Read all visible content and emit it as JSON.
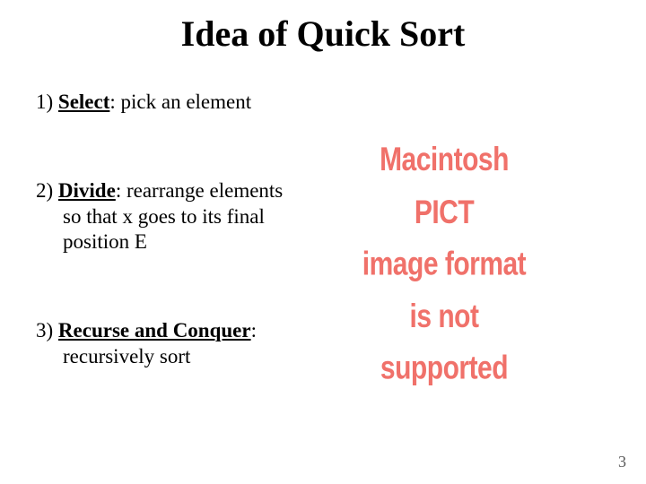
{
  "title": "Idea of Quick Sort",
  "items": {
    "select": {
      "num": "1) ",
      "label": "Select",
      "desc": ": pick an element"
    },
    "divide": {
      "num": "2) ",
      "label": "Divide",
      "desc": ": rearrange elements",
      "cont1": "so that x goes to its final",
      "cont2": "position E"
    },
    "recurse": {
      "num": "3) ",
      "label": "Recurse and Conquer",
      "desc": ":",
      "cont1": "recursively sort"
    }
  },
  "pict": {
    "l1": "Macintosh PICT",
    "l2": "image format",
    "l3": "is not supported"
  },
  "page": "3"
}
